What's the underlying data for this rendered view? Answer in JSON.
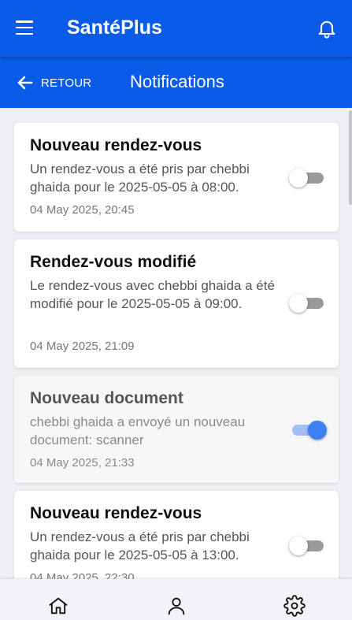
{
  "app": {
    "title": "SantéPlus"
  },
  "header": {
    "menu_icon": "hamburger-menu-icon",
    "bell_icon": "bell-icon"
  },
  "subheader": {
    "back_label": "RETOUR",
    "page_title": "Notifications"
  },
  "notifications": [
    {
      "title": "Nouveau rendez-vous",
      "message": "Un rendez-vous a été pris par chebbi ghaida pour le 2025-05-05 à 08:00.",
      "date": "04 May 2025, 20:45",
      "read": false
    },
    {
      "title": "Rendez-vous modifié",
      "message": "Le rendez-vous avec chebbi ghaida a été modifié pour le 2025-05-05 à 09:00.",
      "date": "04 May 2025, 21:09",
      "read": false
    },
    {
      "title": "Nouveau document",
      "message": "chebbi ghaida a envoyé un nouveau document: scanner",
      "date": "04 May 2025, 21:33",
      "read": true
    },
    {
      "title": "Nouveau rendez-vous",
      "message": "Un rendez-vous a été pris par chebbi ghaida pour le 2025-05-05 à 13:00.",
      "date": "04 May 2025, 22:30",
      "read": false
    }
  ],
  "bottom_nav": [
    "home-icon",
    "user-icon",
    "settings-icon"
  ],
  "colors": {
    "primary": "#0a5be8",
    "toggle_on": "#3b7ff0",
    "toggle_off": "#9a9a9a"
  }
}
